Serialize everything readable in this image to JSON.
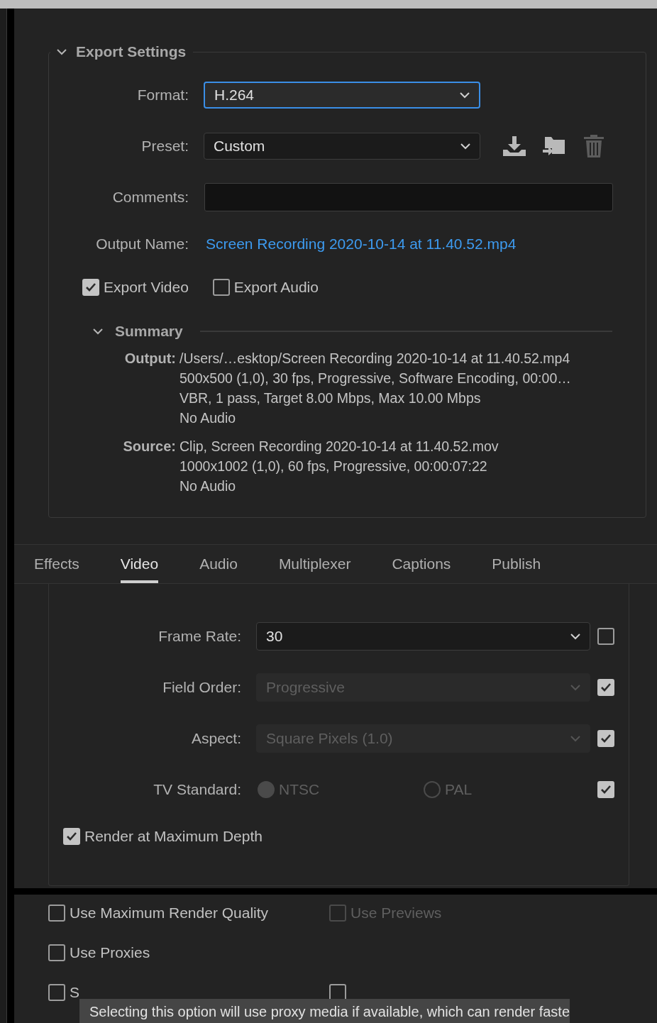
{
  "export_settings": {
    "title": "Export Settings",
    "expanded": true,
    "format": {
      "label": "Format:",
      "value": "H.264",
      "focused": true
    },
    "preset": {
      "label": "Preset:",
      "value": "Custom"
    },
    "comments": {
      "label": "Comments:"
    },
    "output_name": {
      "label": "Output Name:",
      "value": "Screen Recording 2020-10-14 at 11.40.52.mp4"
    },
    "export_options": [
      {
        "label": "Export Video",
        "checked": true
      },
      {
        "label": "Export Audio",
        "checked": false
      }
    ],
    "summary": {
      "title": "Summary",
      "expanded": true,
      "groups": [
        {
          "label": "Output:",
          "lines": [
            "/Users/…esktop/Screen Recording 2020-10-14 at 11.40.52.mp4",
            "500x500 (1,0), 30 fps, Progressive, Software Encoding, 00:00…",
            "VBR, 1 pass, Target 8.00 Mbps, Max 10.00 Mbps",
            "No Audio"
          ]
        },
        {
          "label": "Source:",
          "lines": [
            "Clip, Screen Recording 2020-10-14 at 11.40.52.mov",
            "1000x1002 (1,0), 60 fps, Progressive, 00:00:07:22",
            "No Audio"
          ]
        }
      ]
    }
  },
  "tabs": [
    {
      "label": "Effects",
      "selected": false
    },
    {
      "label": "Video",
      "selected": true
    },
    {
      "label": "Audio",
      "selected": false
    },
    {
      "label": "Multiplexer",
      "selected": false
    },
    {
      "label": "Captions",
      "selected": false
    },
    {
      "label": "Publish",
      "selected": false
    }
  ],
  "video": {
    "rows": [
      {
        "kind": "select",
        "label": "Frame Rate:",
        "value": "30",
        "disabled": false,
        "checked": false
      },
      {
        "kind": "select",
        "label": "Field Order:",
        "value": "Progressive",
        "disabled": true,
        "checked": true
      },
      {
        "kind": "select",
        "label": "Aspect:",
        "value": "Square Pixels (1.0)",
        "disabled": true,
        "checked": true
      },
      {
        "kind": "radio",
        "label": "TV Standard:",
        "disabled": true,
        "checked": true,
        "options": [
          {
            "label": "NTSC",
            "selected": true
          },
          {
            "label": "PAL",
            "selected": false
          }
        ]
      }
    ],
    "render_max_depth": {
      "label": "Render at Maximum Depth",
      "checked": true
    }
  },
  "render_options": [
    {
      "items": [
        {
          "label": "Use Maximum Render Quality",
          "checked": false,
          "disabled": false
        },
        {
          "label": "Use Previews",
          "checked": false,
          "disabled": true
        }
      ]
    },
    {
      "items": [
        {
          "label": "Use Proxies",
          "checked": false,
          "disabled": false
        }
      ]
    },
    {
      "items": [
        {
          "label": "S",
          "checked": false,
          "disabled": false
        },
        {
          "checked": false,
          "disabled": false
        }
      ]
    }
  ],
  "tooltip": "Selecting this option will use proxy media if available, which can render faste"
}
